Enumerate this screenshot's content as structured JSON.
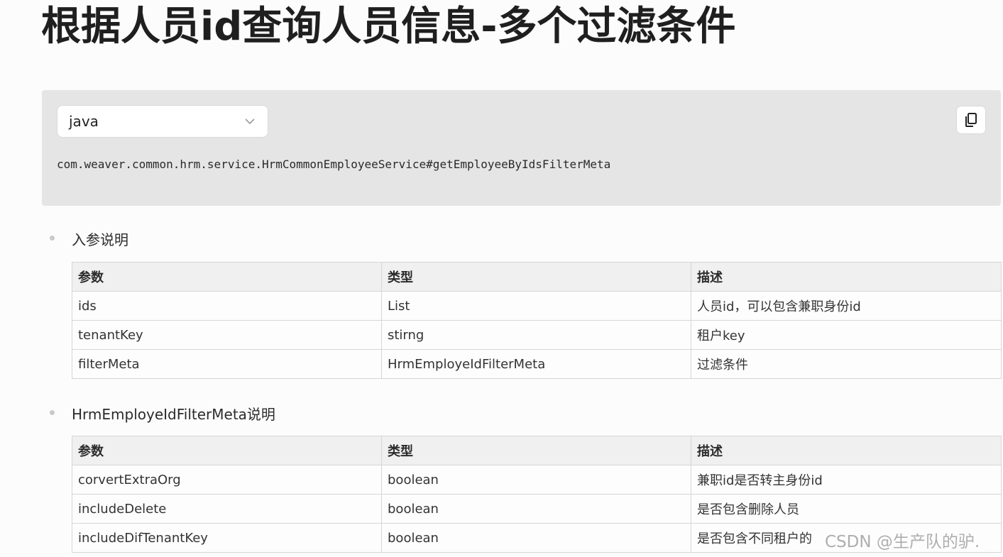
{
  "title": "根据人员id查询人员信息-多个过滤条件",
  "code_block": {
    "language": "java",
    "code": "com.weaver.common.hrm.service.HrmCommonEmployeeService#getEmployeeByIdsFilterMeta"
  },
  "sections": [
    {
      "label": "入参说明",
      "headers": [
        "参数",
        "类型",
        "描述"
      ],
      "rows": [
        [
          "ids",
          "List",
          "人员id，可以包含兼职身份id"
        ],
        [
          "tenantKey",
          "stirng",
          "租户key"
        ],
        [
          "filterMeta",
          "HrmEmployeIdFilterMeta",
          "过滤条件"
        ]
      ]
    },
    {
      "label": "HrmEmployeIdFilterMeta说明",
      "headers": [
        "参数",
        "类型",
        "描述"
      ],
      "rows": [
        [
          "corvertExtraOrg",
          "boolean",
          "兼职id是否转主身份id"
        ],
        [
          "includeDelete",
          "boolean",
          "是否包含删除人员"
        ],
        [
          "includeDifTenantKey",
          "boolean",
          "是否包含不同租户的"
        ]
      ]
    }
  ],
  "watermark": "CSDN @生产队的驴.",
  "icons": {
    "select": "chevron-down-icon",
    "copy": "copy-icon"
  },
  "colors": {
    "code_bg": "#e5e5e5",
    "header_bg": "#f0f0f0",
    "border": "#d6d6d6"
  }
}
